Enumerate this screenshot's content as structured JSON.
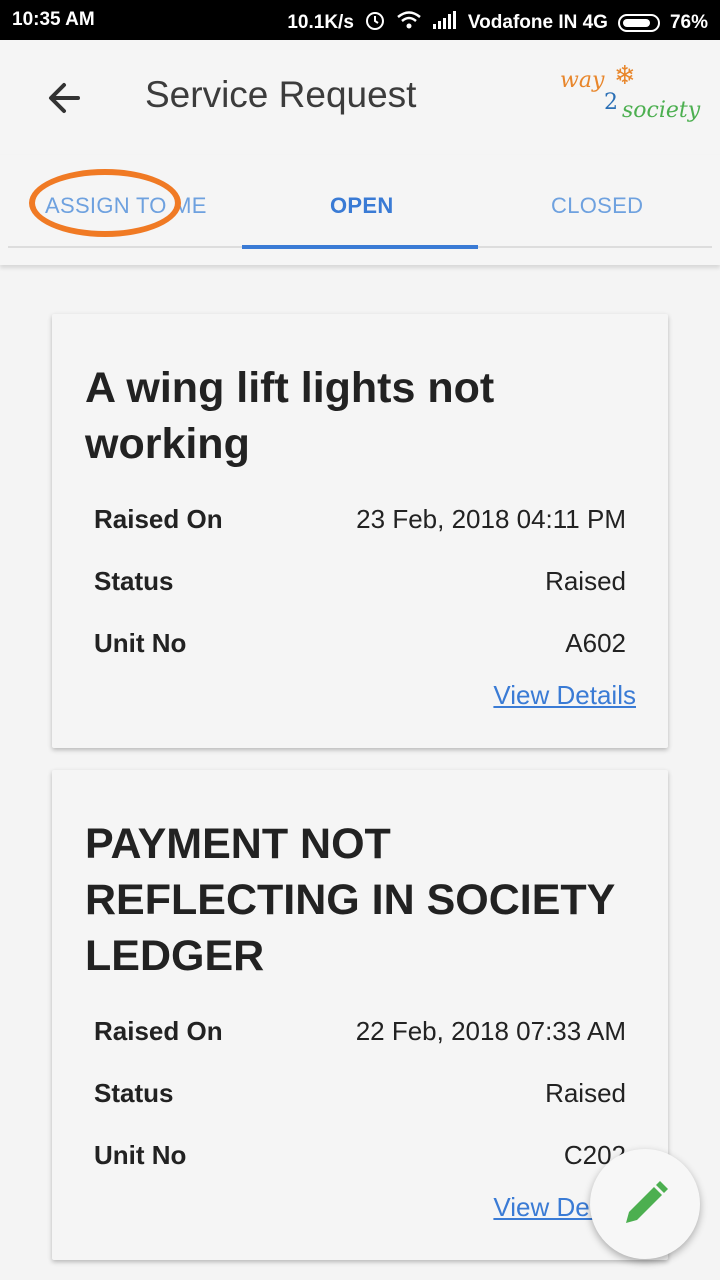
{
  "status_bar": {
    "time": "10:35 AM",
    "speed": "10.1K/s",
    "carrier": "Vodafone IN 4G",
    "battery": "76%"
  },
  "toolbar": {
    "title": "Service Request",
    "logo_text": {
      "way": "way",
      "two": "2",
      "society": "society"
    }
  },
  "tabs": [
    {
      "label": "ASSIGN TO ME"
    },
    {
      "label": "OPEN"
    },
    {
      "label": "CLOSED"
    }
  ],
  "requests": [
    {
      "title": "A wing lift lights not working",
      "raised_on_label": "Raised On",
      "raised_on": "23 Feb, 2018 04:11 PM",
      "status_label": "Status",
      "status": "Raised",
      "unit_label": "Unit No",
      "unit": "A602",
      "link": "View Details"
    },
    {
      "title": "PAYMENT NOT REFLECTING IN SOCIETY LEDGER",
      "raised_on_label": "Raised On",
      "raised_on": "22 Feb, 2018 07:33 AM",
      "status_label": "Status",
      "status": "Raised",
      "unit_label": "Unit No",
      "unit": "C202",
      "link": "View Details"
    }
  ],
  "colors": {
    "accent": "#3a7bd5",
    "highlight": "#f07a24",
    "fab_icon": "#4caf50"
  }
}
